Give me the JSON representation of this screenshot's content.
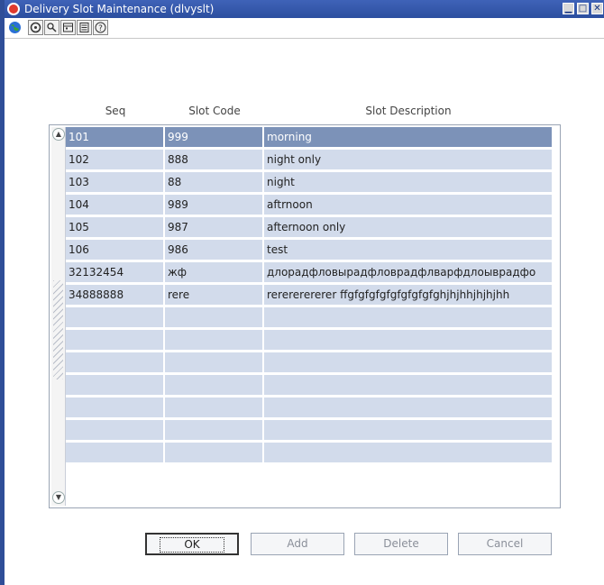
{
  "window": {
    "title": "Delivery Slot Maintenance (dlvyslt)",
    "controls": [
      "minimize",
      "maximize",
      "close"
    ]
  },
  "toolbar": {
    "icons": [
      "globe-icon",
      "help-wizard-icon",
      "find-icon",
      "calendar-icon",
      "notes-icon",
      "question-icon"
    ]
  },
  "table": {
    "columns": [
      "Seq",
      "Slot Code",
      "Slot Description"
    ],
    "rows": [
      {
        "seq": "101",
        "code": "999",
        "desc": "morning",
        "selected": true
      },
      {
        "seq": "102",
        "code": "888",
        "desc": " night only"
      },
      {
        "seq": "103",
        "code": "88",
        "desc": "night"
      },
      {
        "seq": "104",
        "code": "989",
        "desc": "aftrnoon"
      },
      {
        "seq": "105",
        "code": "987",
        "desc": "afternoon only"
      },
      {
        "seq": "106",
        "code": "986",
        "desc": "test"
      },
      {
        "seq": "32132454",
        "code": "жф",
        "desc": "длорадфловырадфловрадфлварфдлоывpадфо"
      },
      {
        "seq": "34888888",
        "code": "rere",
        "desc": "rerererererer ffgfgfgfgfgfgfgfgfghjhjhhjhjhjhh"
      }
    ],
    "empty_rows": 7
  },
  "buttons": {
    "ok": "OK",
    "add": "Add",
    "delete": "Delete",
    "cancel": "Cancel"
  },
  "colors": {
    "titlebar": "#2c4f9f",
    "row": "#d2dbeb",
    "row_selected": "#7c92b8"
  }
}
